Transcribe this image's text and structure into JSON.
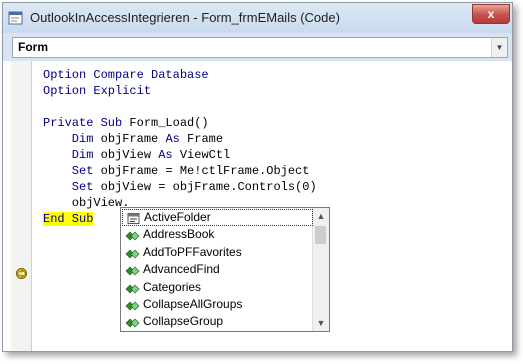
{
  "window": {
    "title": "OutlookInAccessIntegrieren - Form_frmEMails (Code)",
    "close_label": "x"
  },
  "toolbar": {
    "object_combo_value": "Form"
  },
  "code": {
    "lines": [
      [
        {
          "t": "Option Compare Database",
          "k": true
        }
      ],
      [
        {
          "t": "Option Explicit",
          "k": true
        }
      ],
      [],
      [
        {
          "t": "Private Sub",
          "k": true
        },
        {
          "t": " Form_Load()",
          "k": false
        }
      ],
      [
        {
          "t": "    Dim",
          "k": true
        },
        {
          "t": " objFrame ",
          "k": false
        },
        {
          "t": "As",
          "k": true
        },
        {
          "t": " Frame",
          "k": false
        }
      ],
      [
        {
          "t": "    Dim",
          "k": true
        },
        {
          "t": " objView ",
          "k": false
        },
        {
          "t": "As",
          "k": true
        },
        {
          "t": " ViewCtl",
          "k": false
        }
      ],
      [
        {
          "t": "    Set",
          "k": true
        },
        {
          "t": " objFrame = Me!ctlFrame.Object",
          "k": false
        }
      ],
      [
        {
          "t": "    Set",
          "k": true
        },
        {
          "t": " objView = objFrame.Controls(0)",
          "k": false
        }
      ],
      [
        {
          "t": "    objView.",
          "k": false
        }
      ],
      [
        {
          "t": "End Sub",
          "k": true,
          "hl": true
        }
      ]
    ]
  },
  "autocomplete": {
    "selected_index": 0,
    "items": [
      {
        "label": "ActiveFolder",
        "icon": "property-icon"
      },
      {
        "label": "AddressBook",
        "icon": "method-icon"
      },
      {
        "label": "AddToPFFavorites",
        "icon": "method-icon"
      },
      {
        "label": "AdvancedFind",
        "icon": "method-icon"
      },
      {
        "label": "Categories",
        "icon": "method-icon"
      },
      {
        "label": "CollapseAllGroups",
        "icon": "method-icon"
      },
      {
        "label": "CollapseGroup",
        "icon": "method-icon"
      }
    ]
  },
  "colors": {
    "keyword": "#00008b",
    "highlight": "#ffff00",
    "titlebar": "#c9daee"
  }
}
